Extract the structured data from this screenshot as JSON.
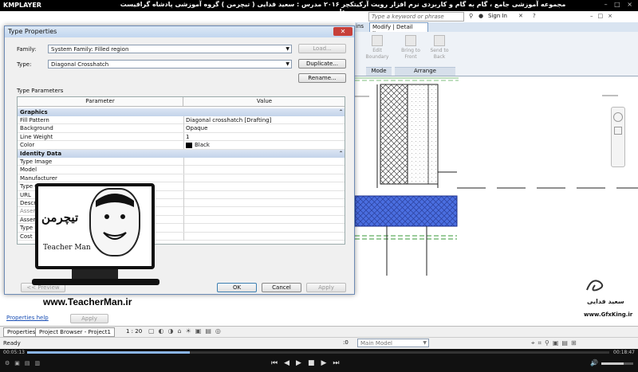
{
  "player": {
    "logo": "KMPLAYER",
    "title": "مجموعه آموزشی جامع ، گام به گام و کاربردی نرم افزار رویت آرکیتکچر ۲۰۱۶ مدرس : سعید فدایی ( تیچرمن ) گروه آموزشی پادشاه گرافیست ها",
    "window_controls": "– □ ×",
    "time_elapsed": "00:05:13",
    "time_total": "00:18:47"
  },
  "revit": {
    "search_placeholder": "Type a keyword or phrase",
    "signin": "Sign In",
    "ribbon_tab_partial": "ins",
    "ribbon_tab_active": "Modify | Detail Items",
    "ribbon": {
      "edit_boundary": "Edit Boundary",
      "bring_to_front": "Bring to Front",
      "send_to_back": "Send to Back",
      "panel_mode": "Mode",
      "panel_arrange": "Arrange"
    },
    "status": {
      "properties_help": "Properties help",
      "apply": "Apply",
      "tab_properties": "Properties",
      "tab_project_browser": "Project Browser - Project1",
      "scale": "1 : 20",
      "ready": "Ready",
      "zero": ":0",
      "model": "Main Model"
    }
  },
  "dialog": {
    "title": "Type Properties",
    "close": "✕",
    "family_label": "Family:",
    "family_value": "System Family: Filled region",
    "type_label": "Type:",
    "type_value": "Diagonal Crosshatch",
    "load": "Load...",
    "duplicate": "Duplicate...",
    "rename": "Rename...",
    "type_parameters": "Type Parameters",
    "col_parameter": "Parameter",
    "col_value": "Value",
    "group_graphics": "Graphics",
    "graphics_rows": [
      {
        "name": "Fill Pattern",
        "value": "Diagonal crosshatch [Drafting]"
      },
      {
        "name": "Background",
        "value": "Opaque"
      },
      {
        "name": "Line Weight",
        "value": "1"
      },
      {
        "name": "Color",
        "value": "Black"
      }
    ],
    "group_identity": "Identity Data",
    "identity_rows": [
      {
        "name": "Type Image",
        "value": ""
      },
      {
        "name": "Model",
        "value": ""
      },
      {
        "name": "Manufacturer",
        "value": ""
      },
      {
        "name": "Type Comments",
        "value": ""
      },
      {
        "name": "URL",
        "value": ""
      },
      {
        "name": "Description",
        "value": ""
      },
      {
        "name": "Assembly Description",
        "value": ""
      },
      {
        "name": "Assembly Code",
        "value": ""
      },
      {
        "name": "Type Mark",
        "value": ""
      },
      {
        "name": "Cost",
        "value": ""
      }
    ],
    "preview": "<< Preview",
    "ok": "OK",
    "cancel": "Cancel",
    "apply": "Apply"
  },
  "watermark": {
    "logo_text": "تیچرمن",
    "logo_sub": "Teacher Man",
    "url": "www.TeacherMan.ir",
    "gfx_name": "سعید فدایی",
    "gfx_url": "www.GfxKing.ir"
  },
  "colors": {
    "fill_blue": "#4a6ee0",
    "dialog_title_bg": "#c2d6ef",
    "group_bg": "#c3d3ea"
  }
}
